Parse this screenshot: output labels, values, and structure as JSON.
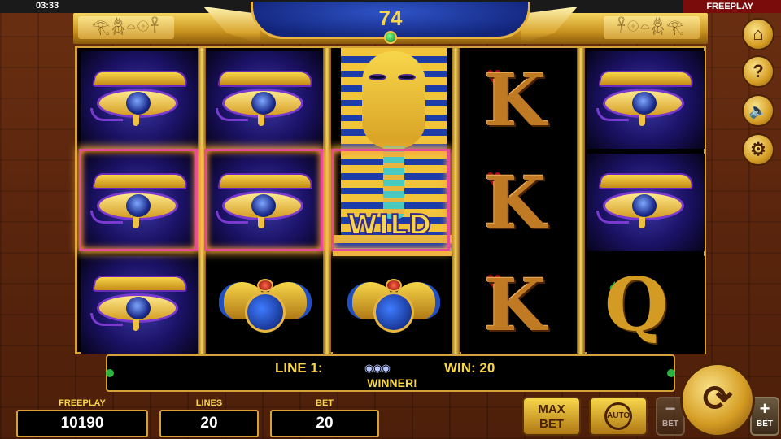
{
  "status_bar": {
    "time": "03:33",
    "mode": "FREEPLAY"
  },
  "header": {
    "counter": "74",
    "hieroglyphs_left": "𓂀𓆣𓏏𓇳𓋹",
    "hieroglyphs_right": "𓋹𓇳𓏏𓆣𓂀"
  },
  "reels": {
    "columns": [
      [
        "eye-of-horus",
        "eye-of-horus",
        "eye-of-horus"
      ],
      [
        "eye-of-horus",
        "eye-of-horus",
        "scarab"
      ],
      [
        "pharaoh-wild",
        "pharaoh-wild",
        "scarab"
      ],
      [
        "K",
        "K",
        "K"
      ],
      [
        "eye-of-horus",
        "eye-of-horus",
        "Q"
      ]
    ],
    "wild_label": "WILD",
    "card_letters": {
      "k": "K",
      "q": "Q"
    }
  },
  "message": {
    "line": "LINE 1:",
    "mini_symbols": "◉◉◉",
    "win": "WIN: 20",
    "status": "WINNER!"
  },
  "stats": {
    "freeplay_label": "FREEPLAY",
    "freeplay_value": "10190",
    "lines_label": "LINES",
    "lines_value": "20",
    "bet_label": "BET",
    "bet_value": "20"
  },
  "controls": {
    "max_bet_line1": "MAX",
    "max_bet_line2": "BET",
    "auto_label": "AUTO",
    "bet_minus_symbol": "−",
    "bet_minus_label": "BET",
    "bet_plus_symbol": "+",
    "bet_plus_label": "BET",
    "spin_symbol": "⟳"
  },
  "side_buttons": {
    "home": "⌂",
    "help": "?",
    "sound": "🔈",
    "settings": "⚙"
  },
  "colors": {
    "gold": "#f7d64a",
    "highlight": "#e84a9a",
    "status_red": "#7a0c0c",
    "gem_green": "#2cb040"
  }
}
